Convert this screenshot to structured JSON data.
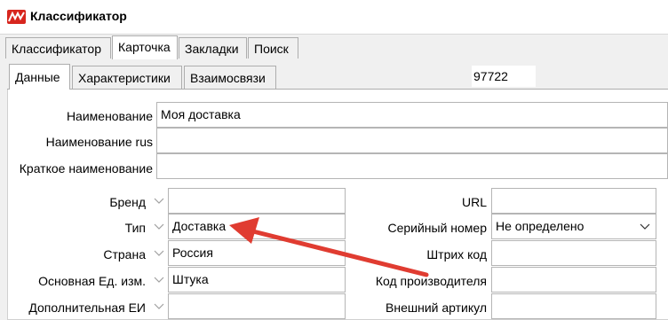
{
  "window": {
    "title": "Классификатор",
    "logo_icon": "app-logo-icon"
  },
  "tabs": [
    {
      "label": "Классификатор"
    },
    {
      "label": "Карточка"
    },
    {
      "label": "Закладки"
    },
    {
      "label": "Поиск"
    }
  ],
  "subtabs": [
    {
      "label": "Данные"
    },
    {
      "label": "Характеристики"
    },
    {
      "label": "Взаимосвязи"
    }
  ],
  "record_id": "97722",
  "form": {
    "name_label": "Наименование",
    "name_value": "Моя доставка",
    "name_rus_label": "Наименование rus",
    "name_rus_value": "",
    "short_name_label": "Краткое наименование",
    "short_name_value": "",
    "brand_label": "Бренд",
    "brand_value": "",
    "type_label": "Тип",
    "type_value": "Доставка",
    "country_label": "Страна",
    "country_value": "Россия",
    "base_unit_label": "Основная Ед. изм.",
    "base_unit_value": "Штука",
    "extra_unit_label": "Дополнительная ЕИ",
    "extra_unit_value": "",
    "url_label": "URL",
    "url_value": "",
    "serial_label": "Серийный номер",
    "serial_value": "Не определено",
    "barcode_label": "Штрих код",
    "barcode_value": "",
    "mfr_code_label": "Код производителя",
    "mfr_code_value": "",
    "ext_article_label": "Внешний артикул",
    "ext_article_value": ""
  },
  "annotation": {
    "arrow_color": "#e03c31"
  },
  "colors": {
    "logo": "#d7261e",
    "window_bg": "#f0f0f0",
    "panel_bg": "#ffffff"
  }
}
